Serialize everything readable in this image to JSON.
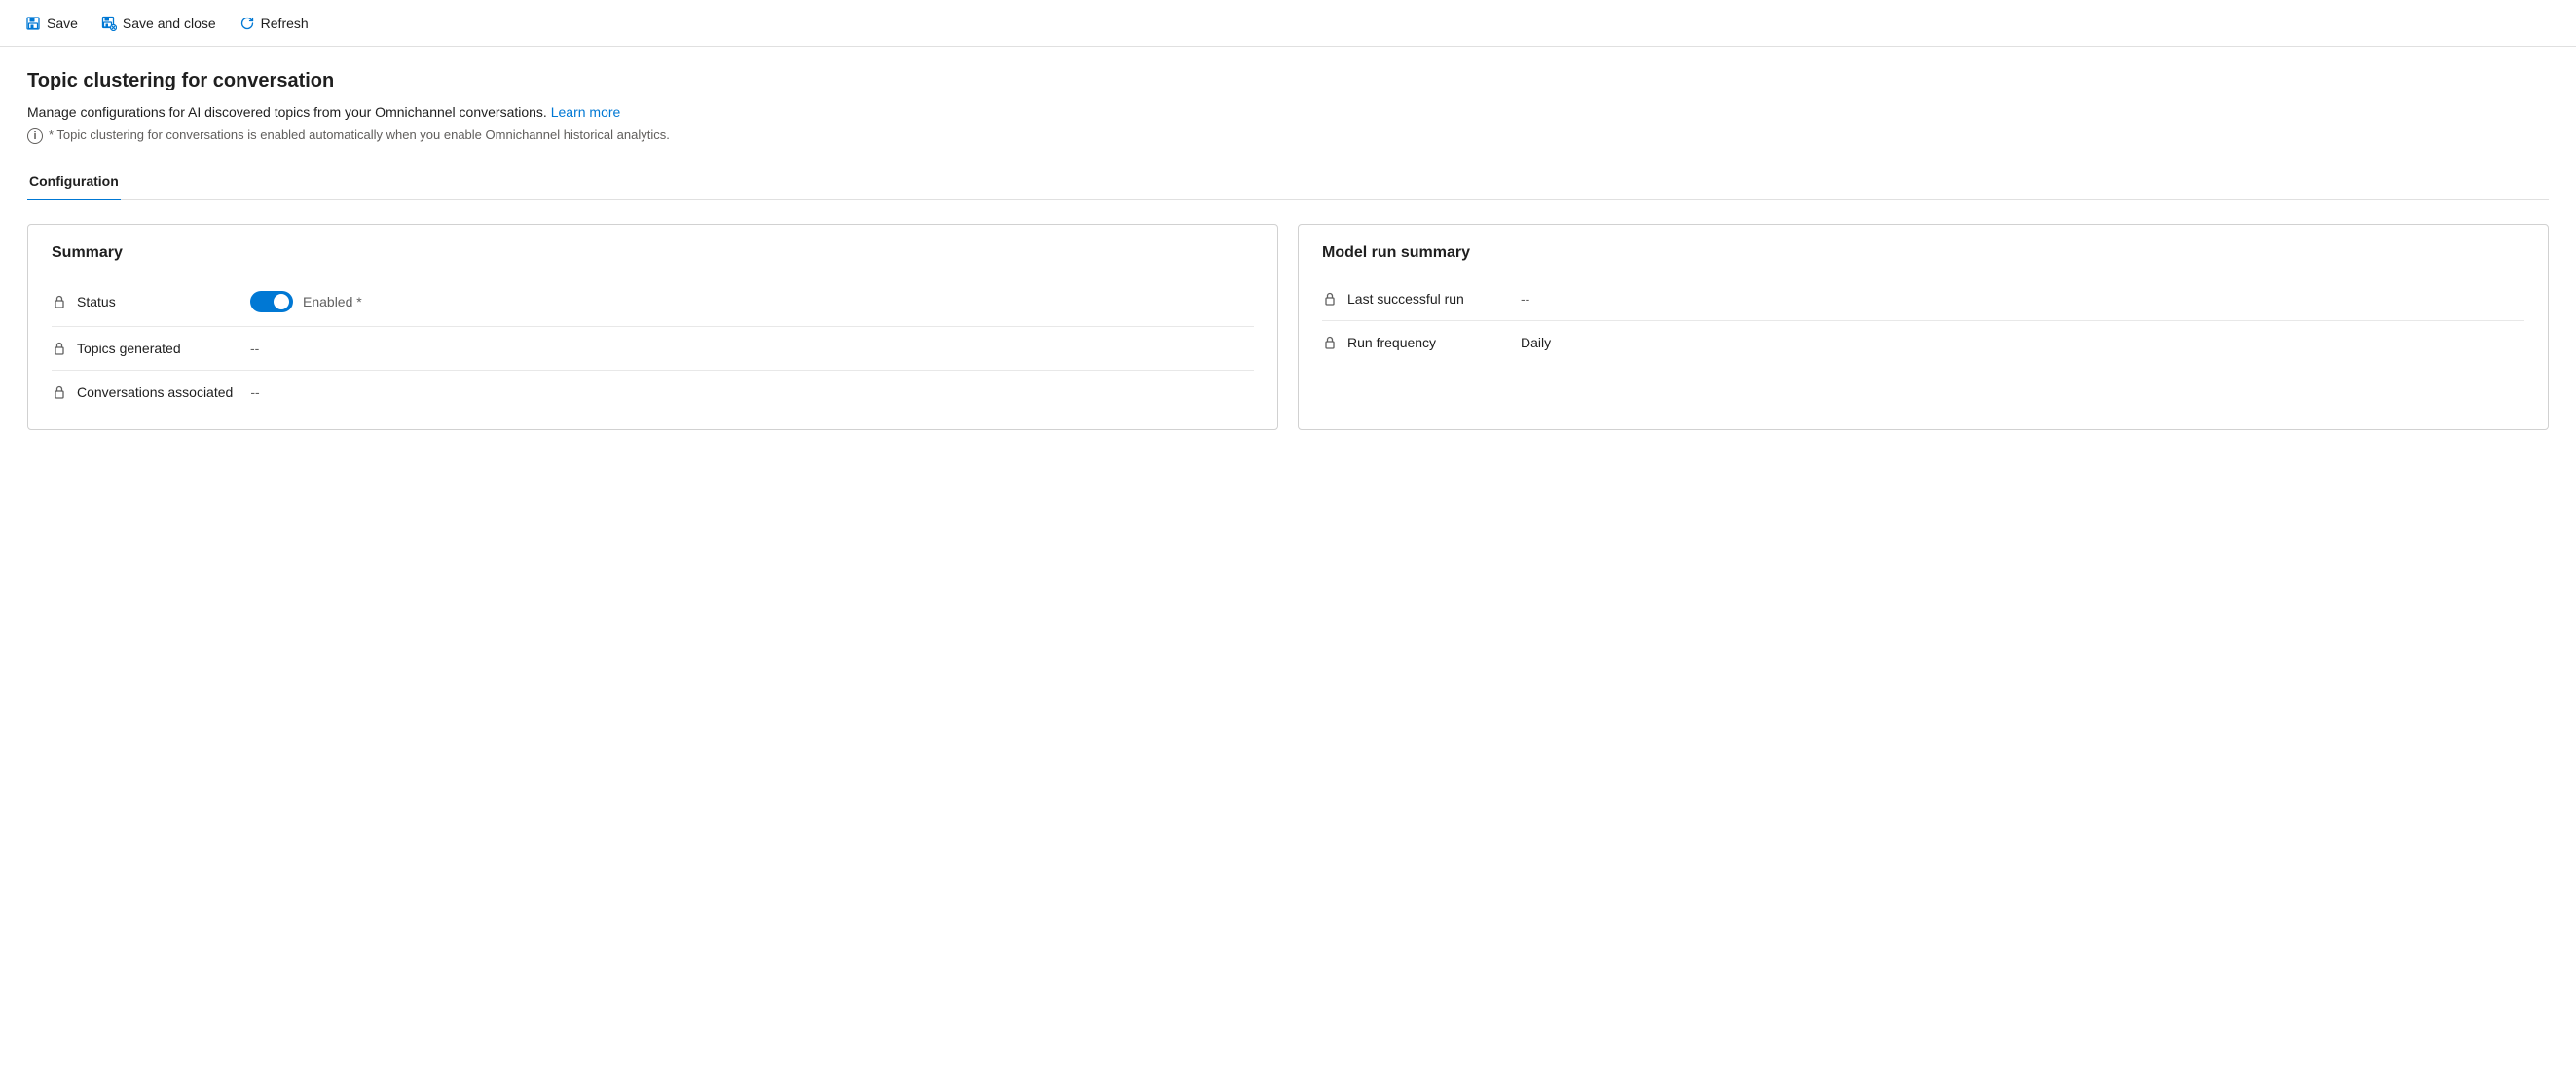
{
  "toolbar": {
    "save_label": "Save",
    "save_close_label": "Save and close",
    "refresh_label": "Refresh"
  },
  "page": {
    "title": "Topic clustering for conversation",
    "description": "Manage configurations for AI discovered topics from your Omnichannel conversations.",
    "learn_more_label": "Learn more",
    "info_note": "* Topic clustering for conversations is enabled automatically when you enable Omnichannel historical analytics."
  },
  "tabs": [
    {
      "label": "Configuration",
      "active": true
    }
  ],
  "summary_card": {
    "title": "Summary",
    "rows": [
      {
        "label": "Status",
        "type": "toggle",
        "toggle_enabled": true,
        "toggle_text": "Enabled *"
      },
      {
        "label": "Topics generated",
        "value": "--"
      },
      {
        "label": "Conversations associated",
        "value": "--"
      }
    ]
  },
  "model_run_card": {
    "title": "Model run summary",
    "rows": [
      {
        "label": "Last successful run",
        "value": "--"
      },
      {
        "label": "Run frequency",
        "value": "Daily"
      }
    ]
  }
}
